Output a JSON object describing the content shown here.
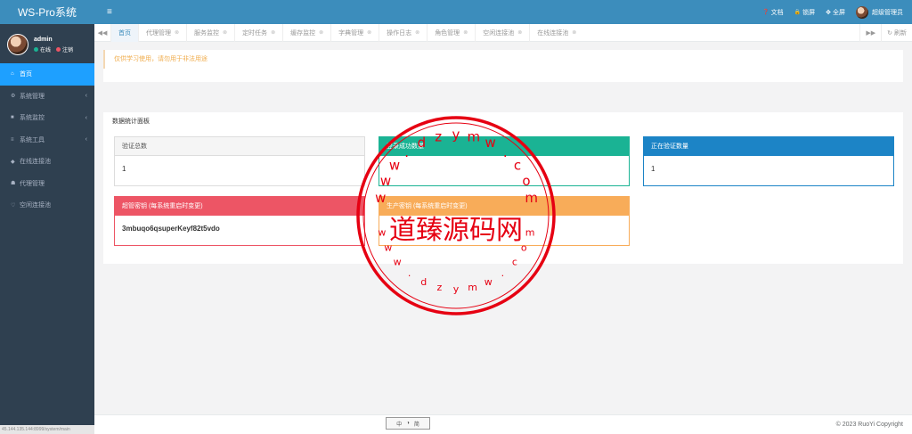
{
  "app": {
    "title": "WS-Pro系统"
  },
  "user": {
    "name": "admin",
    "online": "在线",
    "logout": "注销"
  },
  "sidebar": {
    "items": [
      {
        "label": "首页",
        "icon": "home-icon",
        "glyph": "⌂",
        "active": true,
        "arrow": ""
      },
      {
        "label": "系统管理",
        "icon": "gear-icon",
        "glyph": "⚙",
        "arrow": "‹"
      },
      {
        "label": "系统监控",
        "icon": "video-icon",
        "glyph": "■",
        "arrow": "‹"
      },
      {
        "label": "系统工具",
        "icon": "bars-icon",
        "glyph": "≡",
        "arrow": "‹"
      },
      {
        "label": "在线连接池",
        "icon": "diamond-icon",
        "glyph": "◆",
        "arrow": ""
      },
      {
        "label": "代理管理",
        "icon": "users-icon",
        "glyph": "☗",
        "arrow": ""
      },
      {
        "label": "空闲连接池",
        "icon": "heart-icon",
        "glyph": "♡",
        "arrow": ""
      }
    ],
    "status_url": "45.144.135.144:8999/system/main"
  },
  "topbar": {
    "menu_glyph": "≡",
    "docs": "文档",
    "docs_glyph": "❓",
    "lock": "锁屏",
    "lock_glyph": "🔒",
    "fullscreen": "全屏",
    "fullscreen_glyph": "✥",
    "role": "超级管理员"
  },
  "tabs": {
    "prev_glyph": "◀◀",
    "next_glyph": "▶▶",
    "refresh": "刷新",
    "refresh_glyph": "↻",
    "close_glyph": "⊗",
    "items": [
      {
        "label": "首页",
        "active": true
      },
      {
        "label": "代理管理"
      },
      {
        "label": "服务监控"
      },
      {
        "label": "定时任务"
      },
      {
        "label": "缓存监控"
      },
      {
        "label": "字典管理"
      },
      {
        "label": "操作日志"
      },
      {
        "label": "角色管理"
      },
      {
        "label": "空闲连接池"
      },
      {
        "label": "在线连接池"
      }
    ]
  },
  "notice": "仅供学习使用，请勿用于非法用途",
  "stats": {
    "title": "数据统计面板",
    "cards": [
      {
        "title": "验证总数",
        "value": "1"
      },
      {
        "title": "登录成功数量",
        "value": ""
      },
      {
        "title": "正在验证数量",
        "value": "1"
      },
      {
        "title": "超管密钥 (每系统重启时变更)",
        "value": "3mbuqo6qsuperKeyf82t5vdo"
      },
      {
        "title": "生产密钥 (每系统重启时变更)",
        "value": ""
      }
    ]
  },
  "footer": {
    "copyright": "© 2023 RuoYi Copyright",
    "ime": [
      "中",
      "◑",
      "简"
    ]
  },
  "watermark": {
    "name": "道臻源码网",
    "site": "www.dzymw.com"
  },
  "colors": {
    "sidebar": "#2f4050",
    "topbar": "#3c8dbc",
    "active": "#1ea0ff",
    "green": "#1ab394",
    "blue": "#1c84c6",
    "red": "#ed5565",
    "orange": "#f8ac59"
  }
}
